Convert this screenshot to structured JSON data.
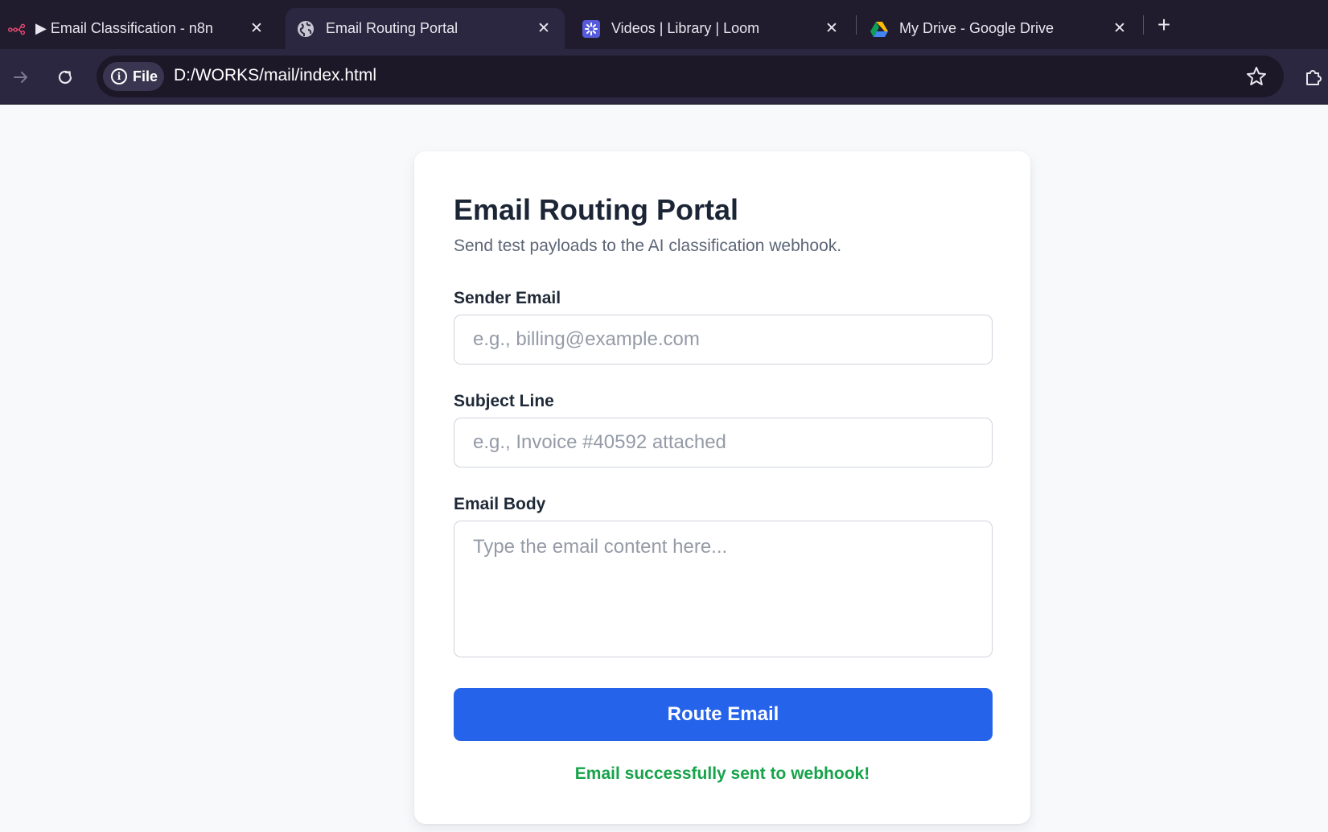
{
  "browser": {
    "tabs": [
      {
        "title": "▶ Email Classification - n8n",
        "icon": "n8n-logo-icon",
        "active": false
      },
      {
        "title": "Email Routing Portal",
        "icon": "globe-icon",
        "active": true
      },
      {
        "title": "Videos | Library | Loom",
        "icon": "loom-logo-icon",
        "active": false
      },
      {
        "title": "My Drive - Google Drive",
        "icon": "google-drive-icon",
        "active": false
      }
    ],
    "close_glyph": "✕",
    "new_tab_glyph": "+",
    "address": {
      "chip_label": "File",
      "info_glyph": "i",
      "url": "D:/WORKS/mail/index.html"
    }
  },
  "portal": {
    "title": "Email Routing Portal",
    "subtitle": "Send test payloads to the AI classification webhook.",
    "fields": {
      "sender": {
        "label": "Sender Email",
        "placeholder": "e.g., billing@example.com",
        "value": ""
      },
      "subject": {
        "label": "Subject Line",
        "placeholder": "e.g., Invoice #40592 attached",
        "value": ""
      },
      "body": {
        "label": "Email Body",
        "placeholder": "Type the email content here...",
        "value": ""
      }
    },
    "submit_label": "Route Email",
    "status_message": "Email successfully sent to webhook!"
  },
  "colors": {
    "accent": "#2563eb",
    "success": "#16a34a",
    "title_text": "#1b2535",
    "chrome_bg": "#201c2e"
  }
}
